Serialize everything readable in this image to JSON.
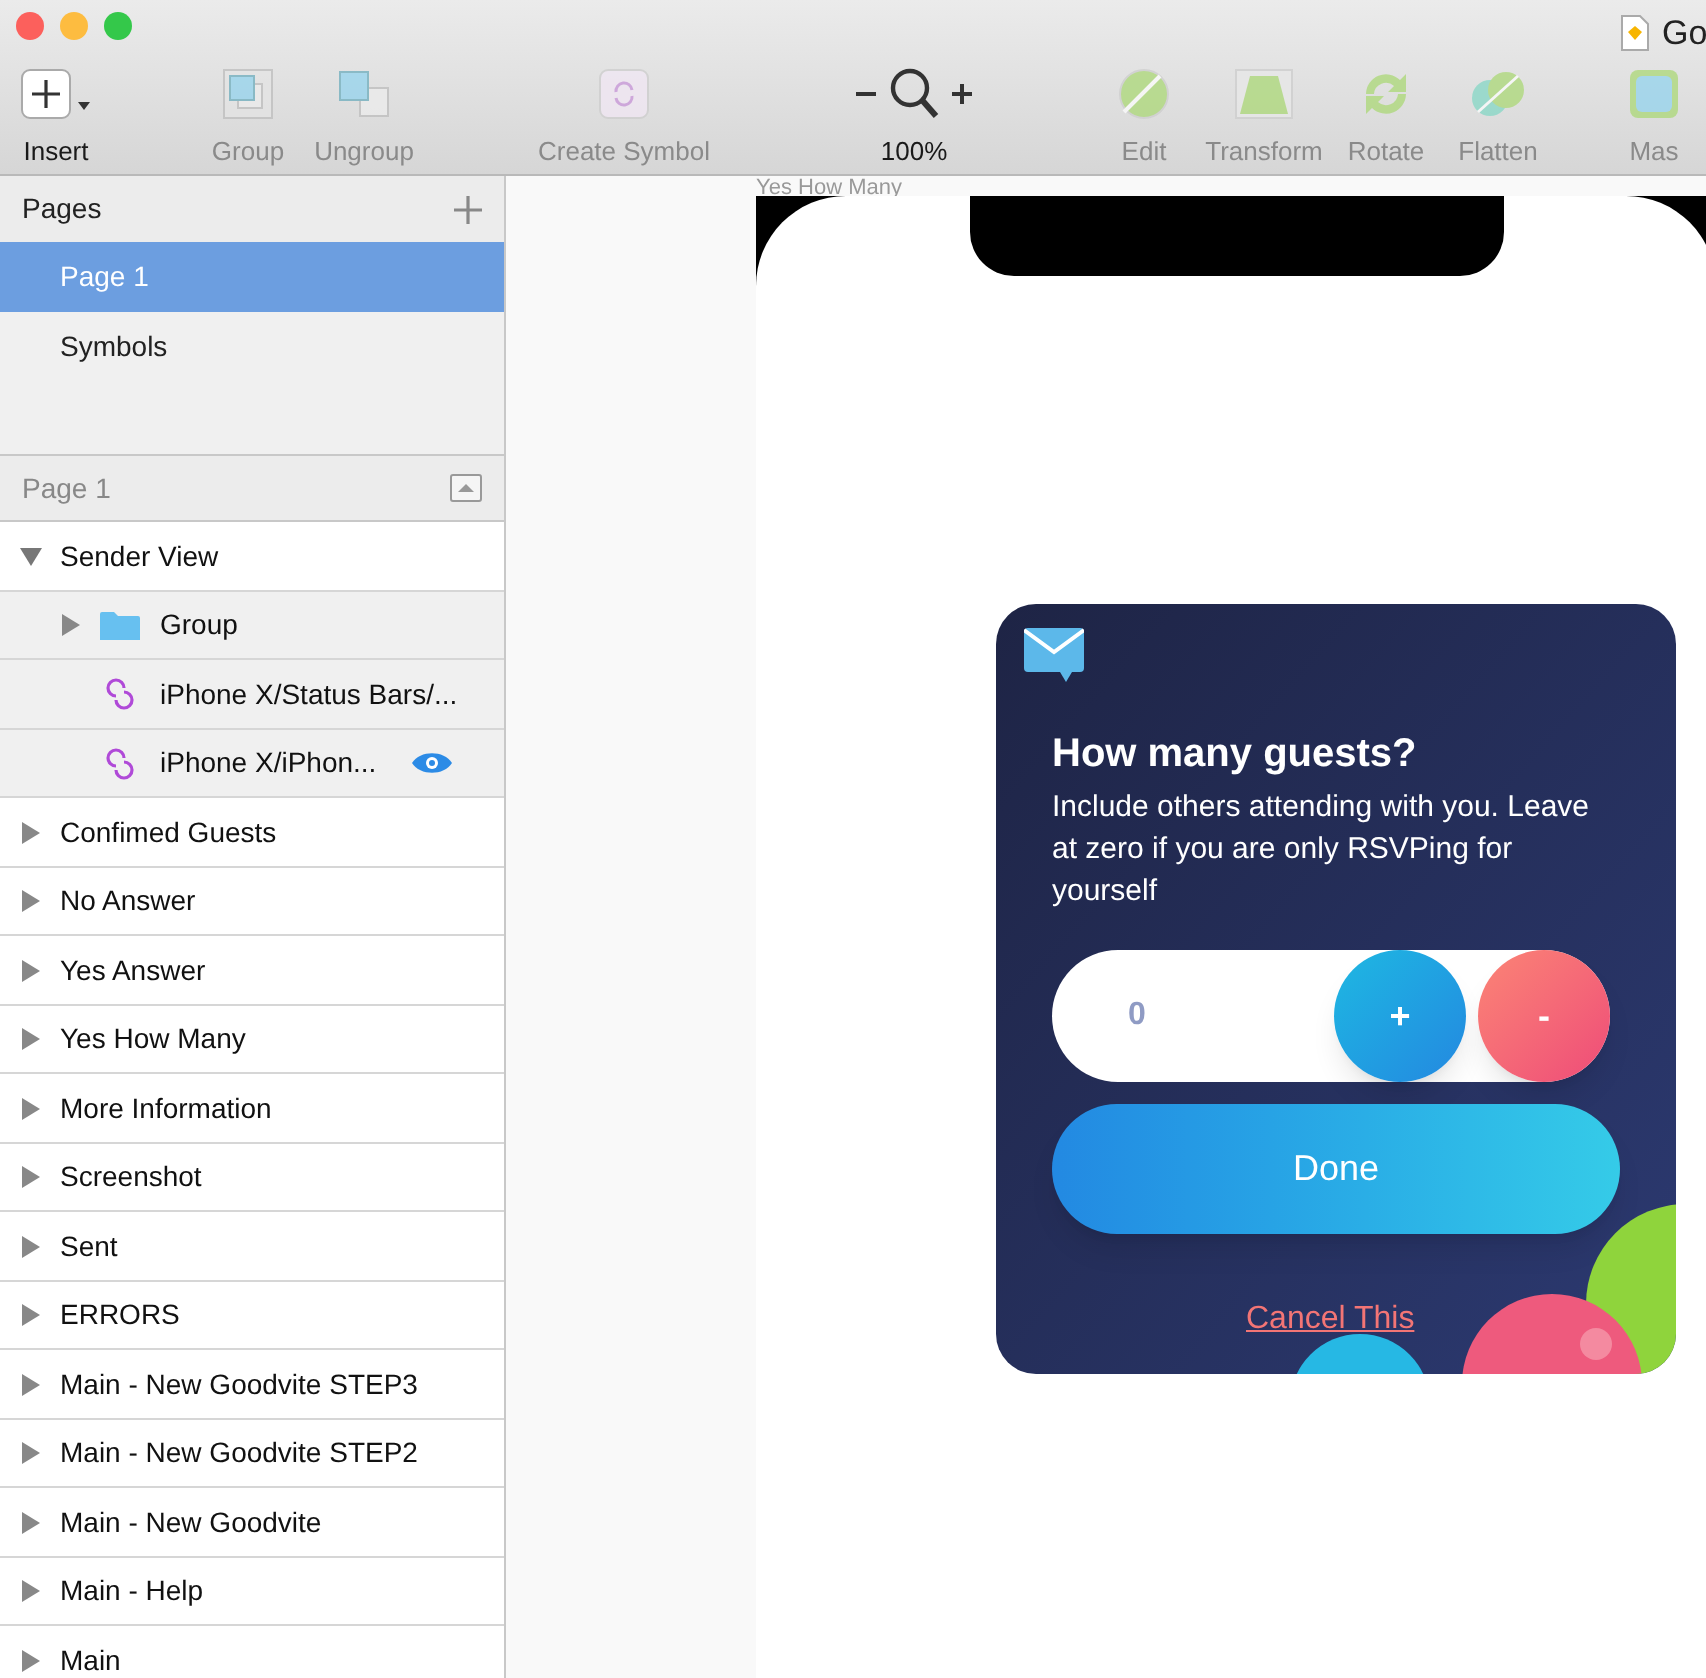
{
  "window": {
    "title": "Go"
  },
  "toolbar": [
    {
      "label": "Insert",
      "kind": "insert",
      "disabled": false
    },
    {
      "label": "Group",
      "kind": "group",
      "disabled": true
    },
    {
      "label": "Ungroup",
      "kind": "ungroup",
      "disabled": true
    },
    {
      "label": "Create Symbol",
      "kind": "symbol",
      "disabled": true
    },
    {
      "label": "100%",
      "kind": "zoom",
      "disabled": false
    },
    {
      "label": "Edit",
      "kind": "edit",
      "disabled": true
    },
    {
      "label": "Transform",
      "kind": "transform",
      "disabled": true
    },
    {
      "label": "Rotate",
      "kind": "rotate",
      "disabled": true
    },
    {
      "label": "Flatten",
      "kind": "flatten",
      "disabled": true
    },
    {
      "label": "Mas",
      "kind": "mask",
      "disabled": true
    }
  ],
  "pages": {
    "title": "Pages",
    "items": [
      {
        "label": "Page 1",
        "selected": true
      },
      {
        "label": "Symbols",
        "selected": false
      }
    ]
  },
  "layers": {
    "title": "Page 1",
    "items": [
      {
        "name": "Sender View",
        "kind": "artboard",
        "expanded": true,
        "children": [
          {
            "name": "Group",
            "kind": "group",
            "expanded": false
          },
          {
            "name": "iPhone X/Status Bars/...",
            "kind": "symbol",
            "eye": false
          },
          {
            "name": "iPhone X/iPhon...",
            "kind": "symbol",
            "eye": true
          }
        ]
      },
      {
        "name": "Confimed Guests",
        "kind": "artboard",
        "expanded": false
      },
      {
        "name": "No Answer",
        "kind": "artboard",
        "expanded": false
      },
      {
        "name": "Yes Answer",
        "kind": "artboard",
        "expanded": false
      },
      {
        "name": "Yes How Many",
        "kind": "artboard",
        "expanded": false
      },
      {
        "name": "More Information",
        "kind": "artboard",
        "expanded": false
      },
      {
        "name": "Screenshot",
        "kind": "artboard",
        "expanded": false
      },
      {
        "name": "Sent",
        "kind": "artboard",
        "expanded": false
      },
      {
        "name": "ERRORS",
        "kind": "artboard",
        "expanded": false
      },
      {
        "name": "Main - New Goodvite STEP3",
        "kind": "artboard",
        "expanded": false
      },
      {
        "name": "Main - New Goodvite STEP2",
        "kind": "artboard",
        "expanded": false
      },
      {
        "name": "Main - New Goodvite",
        "kind": "artboard",
        "expanded": false
      },
      {
        "name": "Main - Help",
        "kind": "artboard",
        "expanded": false
      },
      {
        "name": "Main",
        "kind": "artboard",
        "expanded": false
      }
    ]
  },
  "canvas": {
    "artboard_label": "Yes How Many",
    "card": {
      "title": "How many guests?",
      "text": "Include others attending with you. Leave at zero if you are only RSVPing for yourself",
      "count": {
        "value": "0"
      },
      "plus": "+",
      "minus": "-",
      "done": "Done",
      "cancel": "Cancel This"
    }
  }
}
